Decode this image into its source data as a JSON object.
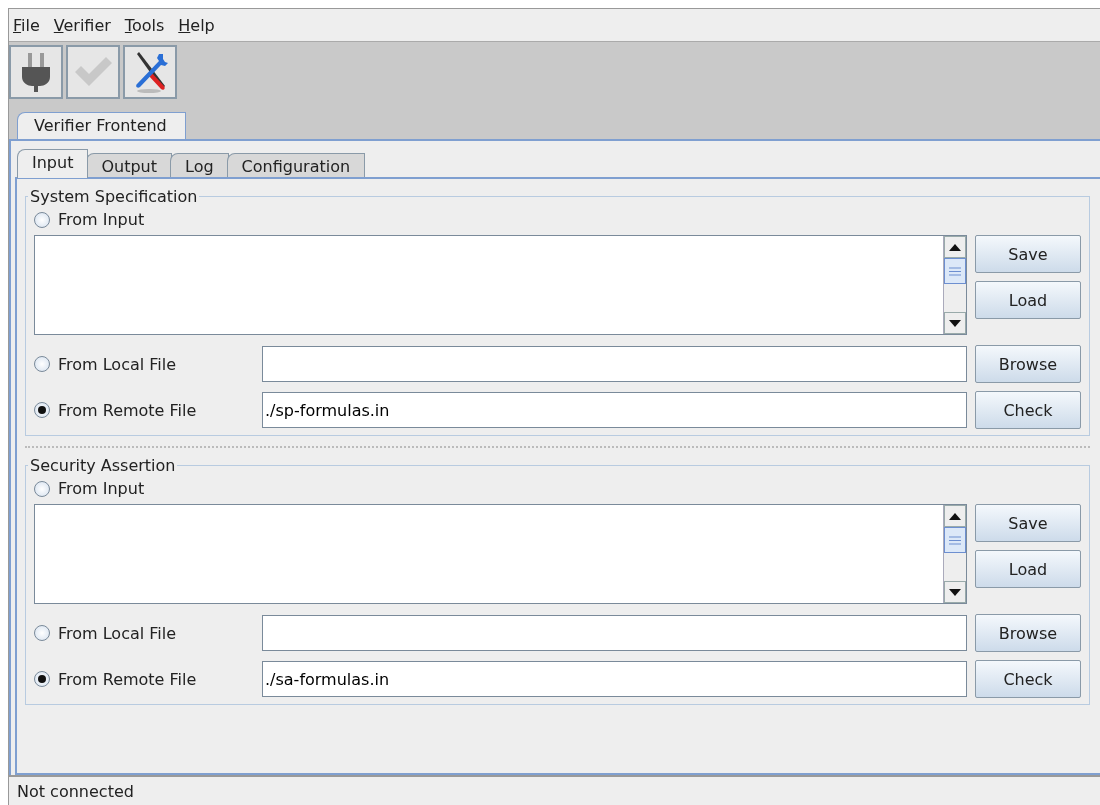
{
  "menu": [
    {
      "label": "File"
    },
    {
      "label": "Verifier"
    },
    {
      "label": "Tools"
    },
    {
      "label": "Help"
    }
  ],
  "toolbar": [
    {
      "kind": "plug",
      "disabled": false
    },
    {
      "kind": "check",
      "disabled": true
    },
    {
      "kind": "tools",
      "disabled": false
    }
  ],
  "outer_tabs": [
    {
      "label": "Verifier Frontend",
      "selected": true
    }
  ],
  "tabs": [
    {
      "label": "Input",
      "selected": true
    },
    {
      "label": "Output",
      "selected": false
    },
    {
      "label": "Log",
      "selected": false
    },
    {
      "label": "Configuration",
      "selected": false
    }
  ],
  "sections": [
    {
      "title": "System Specification",
      "input_option": {
        "label": "From Input",
        "selected": false
      },
      "buttons": [
        "Save",
        "Load"
      ],
      "local_option": {
        "label": "From Local File",
        "selected": false
      },
      "browse_button": "Browse",
      "remote_option": {
        "label": "From Remote File",
        "selected": true
      },
      "remote_value": "./sp-formulas.in",
      "check_button": "Check"
    },
    {
      "title": "Security Assertion",
      "input_option": {
        "label": "From Input",
        "selected": false
      },
      "buttons": [
        "Save",
        "Load"
      ],
      "local_option": {
        "label": "From Local File",
        "selected": false
      },
      "browse_button": "Browse",
      "remote_option": {
        "label": "From Remote File",
        "selected": true
      },
      "remote_value": "./sa-formulas.in",
      "check_button": "Check"
    }
  ],
  "status_bar": "Not connected"
}
